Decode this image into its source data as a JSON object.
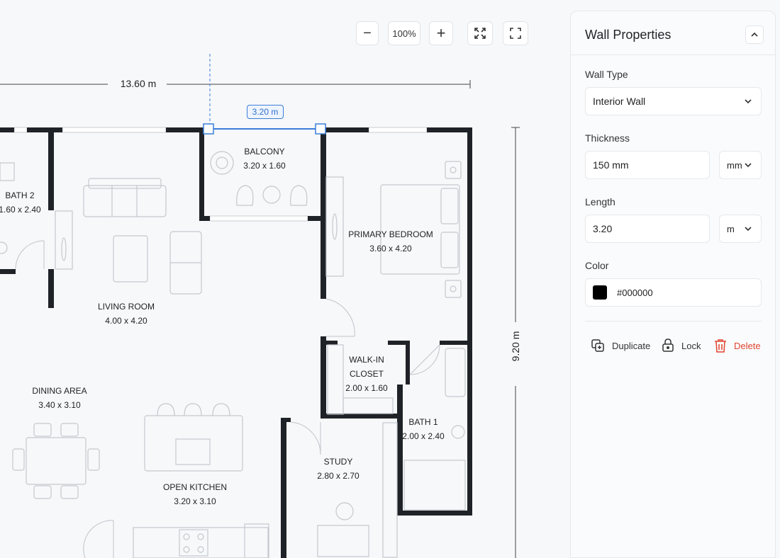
{
  "toolbar": {
    "zoom_out_label": "−",
    "zoom_level": "100%",
    "zoom_in_label": "+",
    "fit_icon": "fit-to-screen-icon",
    "fullscreen_icon": "fullscreen-icon"
  },
  "canvas": {
    "width_dimension": "13.60 m",
    "height_dimension": "9.20 m",
    "selected_wall_length": "3.20 m",
    "rooms": [
      {
        "name": "BALCONY",
        "size": "3.20 x 1.60"
      },
      {
        "name": "BATH 2",
        "size": "1.60 x 2.40"
      },
      {
        "name": "PRIMARY BEDROOM",
        "size": "3.60 x 4.20"
      },
      {
        "name": "LIVING ROOM",
        "size": "4.00 x 4.20"
      },
      {
        "name": "WALK-IN",
        "name2": "CLOSET",
        "size": "2.00 x 1.60"
      },
      {
        "name": "DINING AREA",
        "size": "3.40 x 3.10"
      },
      {
        "name": "BATH 1",
        "size": "2.00 x 2.40"
      },
      {
        "name": "STUDY",
        "size": "2.80 x 2.70"
      },
      {
        "name": "OPEN KITCHEN",
        "size": "3.20 x 3.10"
      }
    ]
  },
  "panel": {
    "title": "Wall Properties",
    "wall_type": {
      "label": "Wall Type",
      "value": "Interior Wall"
    },
    "thickness": {
      "label": "Thickness",
      "value": "150 mm",
      "unit": "mm"
    },
    "length": {
      "label": "Length",
      "value": "3.20",
      "unit": "m"
    },
    "color": {
      "label": "Color",
      "value": "#000000",
      "swatch": "#000000"
    },
    "actions": {
      "duplicate": "Duplicate",
      "lock": "Lock",
      "delete": "Delete"
    }
  },
  "colors": {
    "wall": "#1f2328",
    "selection": "#3b7dd8",
    "danger": "#e0442f"
  }
}
